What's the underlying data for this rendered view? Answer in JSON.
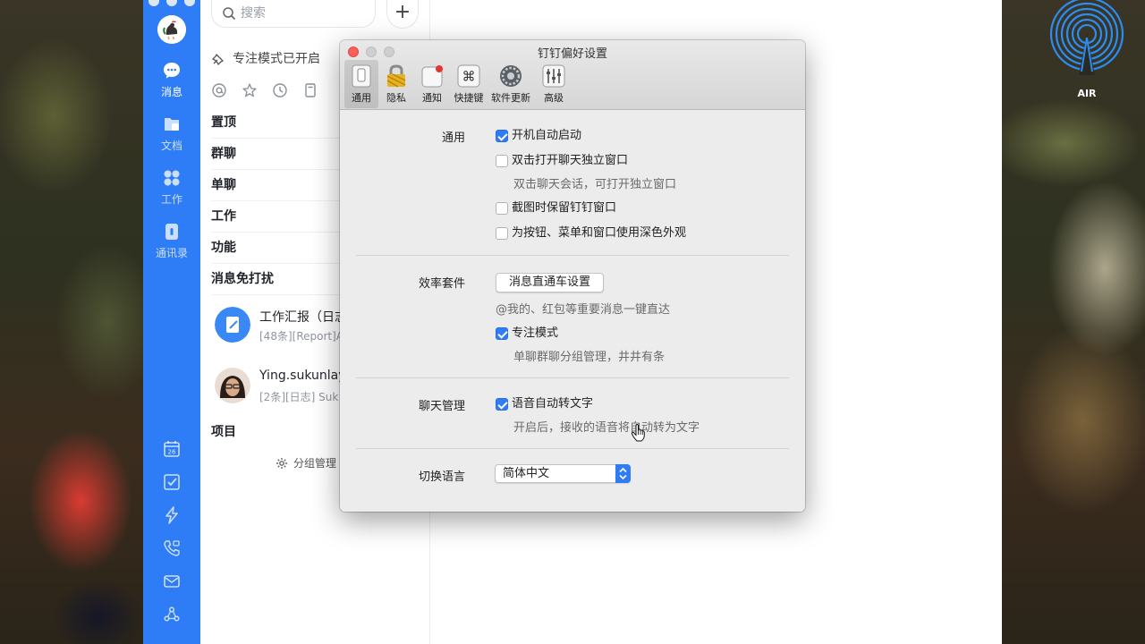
{
  "sidebar": {
    "items": [
      {
        "label": "消息",
        "icon": "chat-bubble-icon",
        "active": true
      },
      {
        "label": "文档",
        "icon": "folder-icon",
        "active": false
      },
      {
        "label": "工作",
        "icon": "grid-icon",
        "active": false
      },
      {
        "label": "通讯录",
        "icon": "contacts-icon",
        "active": false
      }
    ],
    "bottom_icons": [
      "calendar-icon",
      "todo-icon",
      "ding-icon",
      "call-icon",
      "mail-icon",
      "more-apps-icon"
    ],
    "accent": "#2f7df6"
  },
  "conversations": {
    "search_placeholder": "搜索",
    "add_label": "+",
    "focus_mode_label": "专注模式已开启",
    "filter_icons": [
      "at-icon",
      "star-icon",
      "clock-icon",
      "bookmark-icon"
    ],
    "groups": [
      "置顶",
      "群聊",
      "单聊",
      "工作",
      "功能",
      "消息免打扰"
    ],
    "chats": [
      {
        "title": "工作汇报（日志",
        "preview": "[48条][Report]A"
      },
      {
        "title": "Ying.sukunlaya",
        "preview": "[2条][日志] Suk"
      }
    ],
    "project_label": "项目",
    "group_manage_label": "分组管理"
  },
  "air_widget": {
    "label": "AIR"
  },
  "prefs": {
    "window_title": "钉钉偏好设置",
    "tabs": [
      {
        "label": "通用",
        "icon": "phone-icon",
        "active": true
      },
      {
        "label": "隐私",
        "icon": "lock-icon",
        "active": false
      },
      {
        "label": "通知",
        "icon": "notification-icon",
        "active": false
      },
      {
        "label": "快捷键",
        "icon": "command-key-icon",
        "active": false
      },
      {
        "label": "软件更新",
        "icon": "update-gear-icon",
        "active": false
      },
      {
        "label": "高级",
        "icon": "sliders-icon",
        "active": false
      }
    ],
    "general": {
      "label": "通用",
      "auto_start": {
        "label": "开机自动启动",
        "checked": true
      },
      "double_click_window": {
        "label": "双击打开聊天独立窗口",
        "checked": false
      },
      "double_click_hint": "双击聊天会话，可打开独立窗口",
      "keep_window_on_screenshot": {
        "label": "截图时保留钉钉窗口",
        "checked": false
      },
      "dark_appearance": {
        "label": "为按钮、菜单和窗口使用深色外观",
        "checked": false
      }
    },
    "efficiency": {
      "label": "效率套件",
      "button_label": "消息直通车设置",
      "button_hint": "@我的、红包等重要消息一键直达",
      "focus_mode": {
        "label": "专注模式",
        "checked": true
      },
      "focus_hint": "单聊群聊分组管理，井井有条"
    },
    "chat_management": {
      "label": "聊天管理",
      "voice_to_text": {
        "label": "语音自动转文字",
        "checked": true
      },
      "voice_hint": "开启后，接收的语音将自动转为文字"
    },
    "language": {
      "label": "切换语言",
      "selected": "简体中文"
    }
  }
}
